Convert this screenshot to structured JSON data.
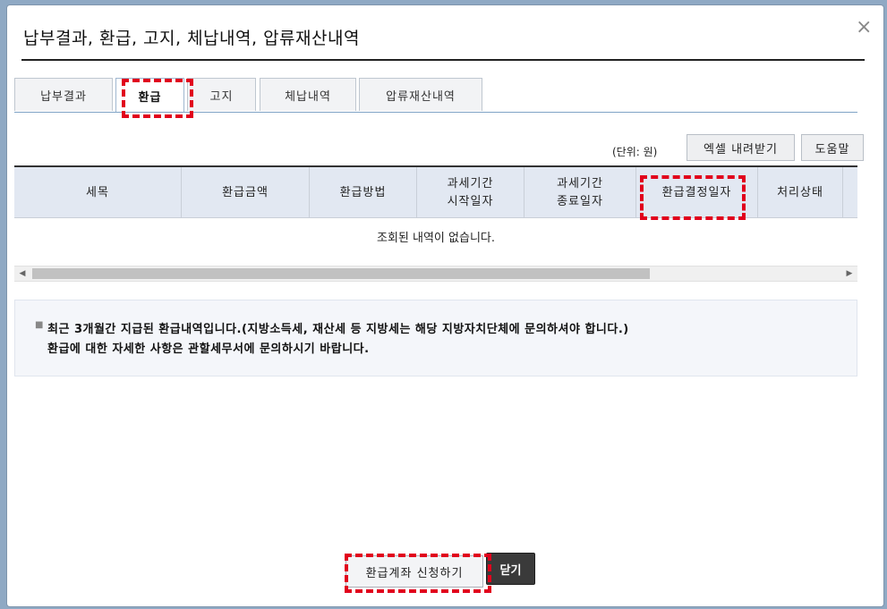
{
  "dialog": {
    "title": "납부결과, 환급, 고지, 체납내역, 압류재산내역",
    "close_icon": "close-icon"
  },
  "tabs": [
    {
      "label": "납부결과",
      "active": false
    },
    {
      "label": "환급",
      "active": true
    },
    {
      "label": "고지",
      "active": false
    },
    {
      "label": "체납내역",
      "active": false
    },
    {
      "label": "압류재산내역",
      "active": false
    }
  ],
  "toolbar": {
    "unit_label": "(단위: 원)",
    "excel_button": "엑셀 내려받기",
    "help_button": "도움말"
  },
  "table": {
    "columns": [
      "세목",
      "환급금액",
      "환급방법",
      "과세기간\n시작일자",
      "과세기간\n종료일자",
      "환급결정일자",
      "처리상태"
    ],
    "empty_message": "조회된 내역이 없습니다."
  },
  "notice": {
    "line1": "최근 3개월간 지급된 환급내역입니다.(지방소득세, 재산세 등 지방세는 해당 지방자치단체에 문의하셔야 합니다.)",
    "line2": "환급에 대한 자세한 사항은 관할세무서에 문의하시기 바랍니다."
  },
  "footer": {
    "refund_account_button": "환급계좌 신청하기",
    "close_button": "닫기"
  },
  "colors": {
    "highlight": "#e1001c",
    "header_bg": "#e2e8f2",
    "close_button_bg": "#3a3a3a"
  }
}
